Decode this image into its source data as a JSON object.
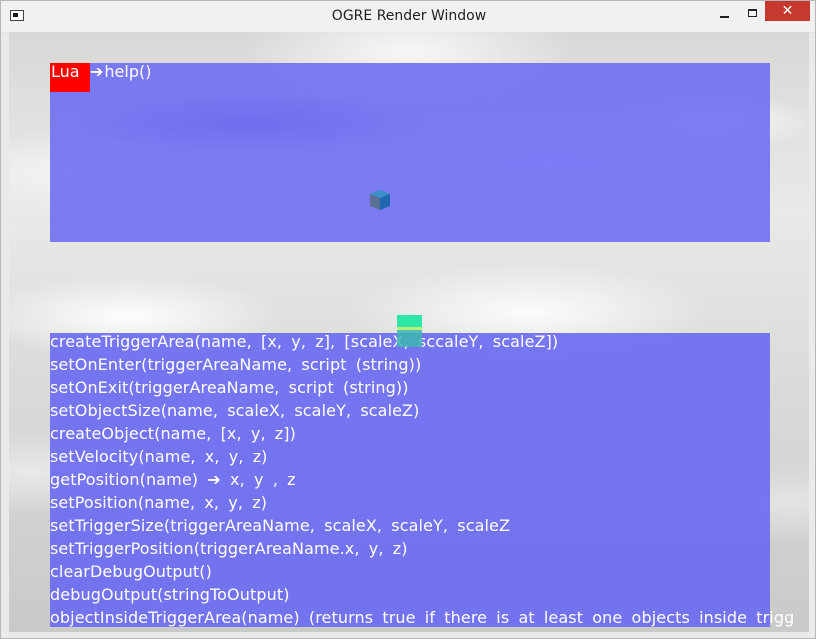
{
  "window": {
    "title": "OGRE Render Window",
    "controls": {
      "close": "✕"
    }
  },
  "console": {
    "language_badge": "Lua",
    "prompt_arrow": "➔",
    "input": "help()"
  },
  "help": {
    "lines": [
      "createTriggerArea(name,  [x,  y,  z],  [scaleX,  sccaleY,  scaleZ])",
      "setOnEnter(triggerAreaName,  script  (string))",
      "setOnExit(triggerAreaName,  script  (string))",
      "setObjectSize(name,  scaleX,  scaleY,  scaleZ)",
      "createObject(name,  [x,  y,  z])",
      "setVelocity(name,  x,  y,  z)",
      "getPosition(name)  ➔  x,  y  ,  z",
      "setPosition(name,  x,  y,  z)",
      "setTriggerSize(triggerAreaName,  scaleX,  scaleY,  scaleZ",
      "setTriggerPosition(triggerAreaName.x,  y,  z)",
      "clearDebugOutput()",
      "debugOutput(stringToOutput)",
      "objectInsideTriggerArea(name)  (returns  true  if  there  is  at  least  one  objects  inside  trigg"
    ]
  },
  "colors": {
    "panel": "#6767f5",
    "badge": "#ff0000",
    "close_button": "#c7382f",
    "cube_top_face": "#2f7fbf",
    "cube_bottom": "#2ee6a6"
  }
}
